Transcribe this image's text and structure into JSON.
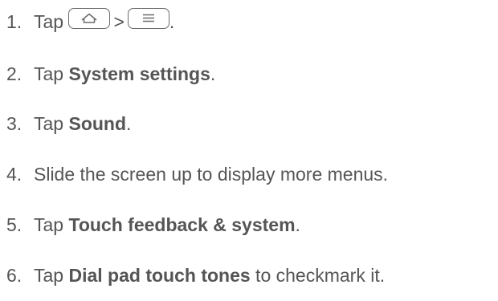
{
  "steps": [
    {
      "number": "1.",
      "prefix": "Tap",
      "home_key_icon": "home-outline-icon",
      "separator": ">",
      "menu_key_icon": "menu-lines-icon",
      "suffix": "."
    },
    {
      "number": "2.",
      "prefix": "Tap ",
      "bold": "System settings",
      "suffix": "."
    },
    {
      "number": "3.",
      "prefix": "Tap ",
      "bold": "Sound",
      "suffix": "."
    },
    {
      "number": "4.",
      "text": "Slide the screen up to display more menus."
    },
    {
      "number": "5.",
      "prefix": "Tap ",
      "bold": "Touch feedback & system",
      "suffix": "."
    },
    {
      "number": "6.",
      "prefix": "Tap ",
      "bold": "Dial pad touch tones",
      "suffix": " to checkmark it."
    }
  ]
}
